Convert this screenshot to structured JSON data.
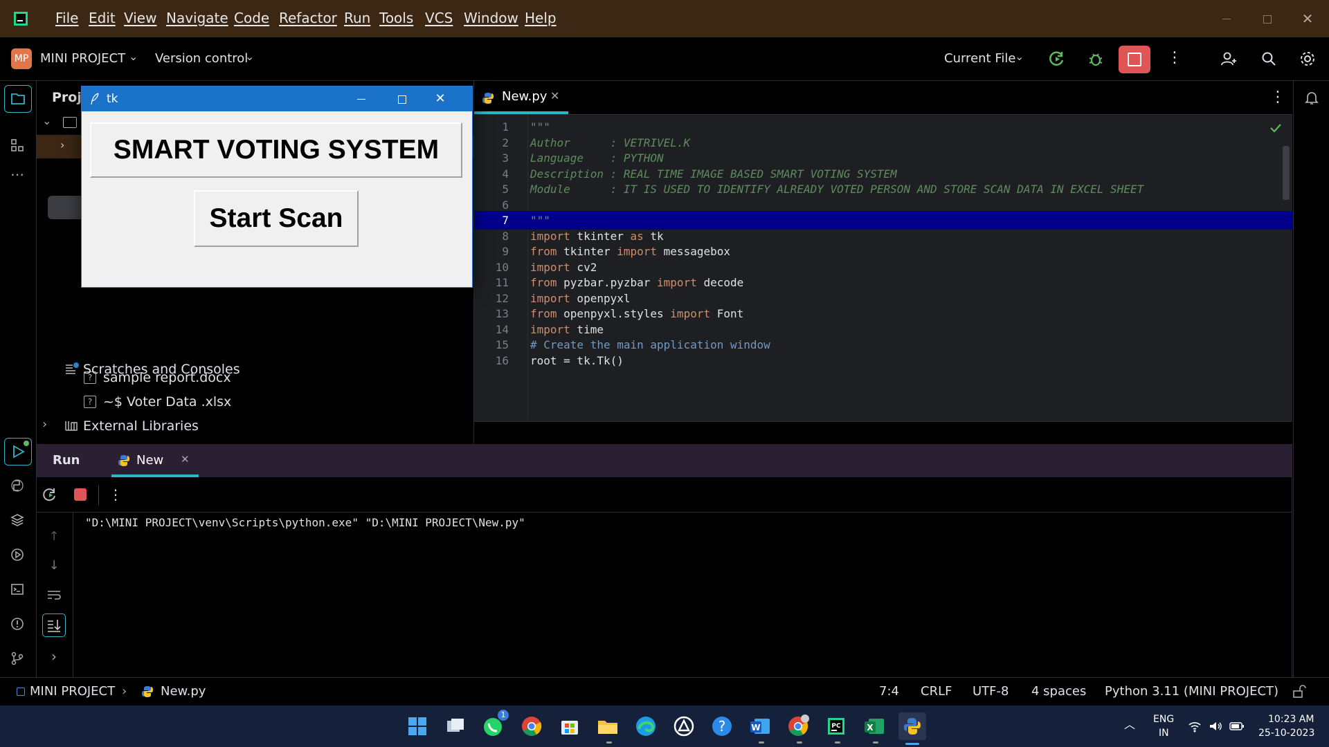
{
  "menubar": {
    "items": [
      "File",
      "Edit",
      "View",
      "Navigate",
      "Code",
      "Refactor",
      "Run",
      "Tools",
      "VCS",
      "Window",
      "Help"
    ]
  },
  "toolbar": {
    "project_badge": "MP",
    "project_name": "MINI PROJECT",
    "version_control": "Version control",
    "run_config": "Current File"
  },
  "project_panel": {
    "title": "Proje",
    "files": [
      {
        "name": "sample report.docx"
      },
      {
        "name": "~$ Voter Data .xlsx"
      }
    ],
    "external_libraries": "External Libraries",
    "scratches": "Scratches and Consoles"
  },
  "tk_window": {
    "title": "tk",
    "heading": "SMART VOTING SYSTEM",
    "button": "Start Scan"
  },
  "editor": {
    "tab": "New.py",
    "lines": [
      {
        "n": "1",
        "text": "\"\"\""
      },
      {
        "n": "2",
        "text": "Author      : VETRIVEL.K"
      },
      {
        "n": "3",
        "text": "Language    : PYTHON"
      },
      {
        "n": "4",
        "text": "Description : REAL TIME IMAGE BASED SMART VOTING SYSTEM"
      },
      {
        "n": "5",
        "text": "Module      : IT IS USED TO IDENTIFY ALREADY VOTED PERSON AND STORE SCAN DATA IN EXCEL SHEET"
      },
      {
        "n": "6",
        "text": ""
      },
      {
        "n": "7",
        "text": "\"\"\""
      },
      {
        "n": "8",
        "kw1": "import",
        "rest1": " tkinter ",
        "kw2": "as",
        "rest2": " tk"
      },
      {
        "n": "9",
        "kw1": "from",
        "rest1": " tkinter ",
        "kw2": "import",
        "rest2": " messagebox"
      },
      {
        "n": "10",
        "kw1": "import",
        "rest1": " cv2"
      },
      {
        "n": "11",
        "kw1": "from",
        "rest1": " pyzbar.pyzbar ",
        "kw2": "import",
        "rest2": " decode"
      },
      {
        "n": "12",
        "kw1": "import",
        "rest1": " openpyxl"
      },
      {
        "n": "13",
        "kw1": "from",
        "rest1": " openpyxl.styles ",
        "kw2": "import",
        "rest2": " Font"
      },
      {
        "n": "14",
        "kw1": "import",
        "rest1": " time"
      },
      {
        "n": "15",
        "comment": "# Create the main application window"
      },
      {
        "n": "16",
        "plain": "root = tk.Tk()"
      }
    ],
    "current_line": "7"
  },
  "run_panel": {
    "title": "Run",
    "tab": "New",
    "console_output": "\"D:\\MINI PROJECT\\venv\\Scripts\\python.exe\" \"D:\\MINI PROJECT\\New.py\""
  },
  "statusbar": {
    "project": "MINI PROJECT",
    "file": "New.py",
    "position": "7:4",
    "line_sep": "CRLF",
    "encoding": "UTF-8",
    "indent": "4 spaces",
    "interpreter": "Python 3.11 (MINI PROJECT)"
  },
  "taskbar": {
    "lang_top": "ENG",
    "lang_bottom": "IN",
    "time": "10:23 AM",
    "date": "25-10-2023",
    "whatsapp_badge": "1"
  },
  "colors": {
    "menubar_bg": "#3b2714",
    "accent": "#2fb5c9",
    "stop_red": "#e05555",
    "selection": "#00008b",
    "taskbar_bg": "#15203a"
  }
}
